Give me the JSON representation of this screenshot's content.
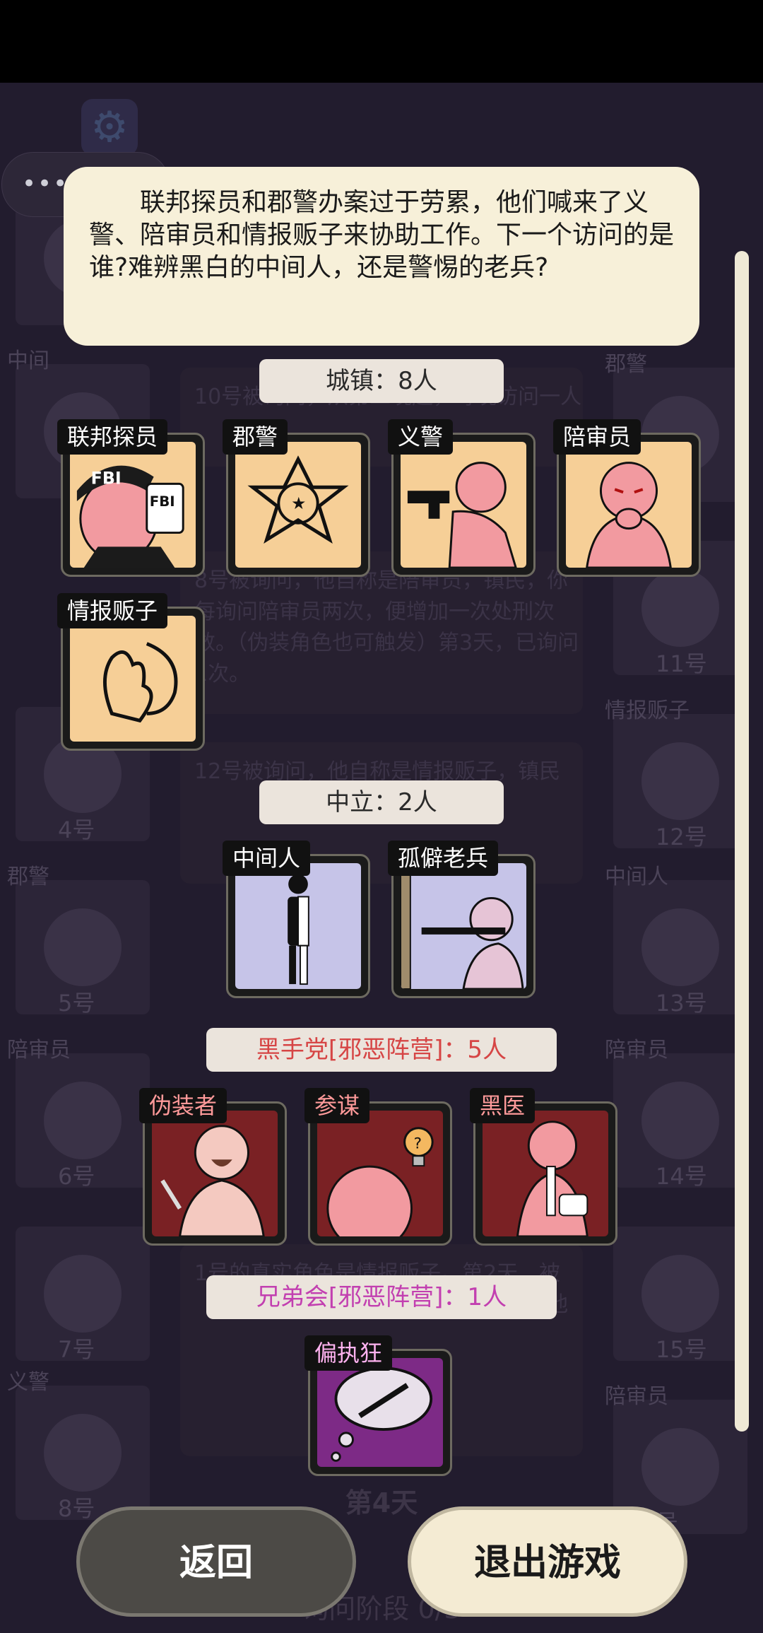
{
  "dialog": {
    "text": "联邦探员和郡警办案过于劳累，他们喊来了义警、陪审员和情报贩子来协助工作。下一个访问的是谁?难辨黑白的中间人，还是警惕的老兵?"
  },
  "sections": {
    "town": {
      "label": "城镇：8人"
    },
    "neutral": {
      "label": "中立：2人"
    },
    "black_hand": {
      "label": "黑手党[邪恶阵营]：5人"
    },
    "brotherhood": {
      "label": "兄弟会[邪恶阵营]：1人"
    }
  },
  "roles": {
    "fbi": "联邦探员",
    "sheriff": "郡警",
    "vigilante": "义警",
    "juror": "陪审员",
    "informant": "情报贩子",
    "middleman": "中间人",
    "veteran": "孤僻老兵",
    "disguiser": "伪装者",
    "strategist": "参谋",
    "doctor": "黑医",
    "paranoid": "偏执狂"
  },
  "buttons": {
    "back": "返回",
    "exit": "退出游戏"
  },
  "background": {
    "left_cards": [
      {
        "tag": "",
        "num": ""
      },
      {
        "tag": "中间",
        "num": ""
      },
      {
        "tag": "",
        "num": "4号"
      },
      {
        "tag": "郡警",
        "num": "5号"
      },
      {
        "tag": "陪审员",
        "num": "6号"
      },
      {
        "tag": "",
        "num": "7号"
      },
      {
        "tag": "义警",
        "num": "8号"
      }
    ],
    "right_cards": [
      {
        "tag": "郡警",
        "num": ""
      },
      {
        "tag": "",
        "num": "11号"
      },
      {
        "tag": "情报贩子",
        "num": "12号"
      },
      {
        "tag": "中间人",
        "num": "13号"
      },
      {
        "tag": "陪审员",
        "num": "14号"
      },
      {
        "tag": "",
        "num": "15号"
      },
      {
        "tag": "陪审员",
        "num": "号"
      }
    ],
    "log1": "10号被询问，从第二晚起，每晚访问一人",
    "log2": "8号被询问，他自称是陪审员，镇民，你每询问陪审员两次，便增加一次处刑次数。（伪装角色也可触发）第3天，已询问1次。",
    "log3": "12号被询问，他自称是情报贩子，镇民",
    "log4": "1号的真实角色是情报贩子。第2天，被（情报贩子）是伪装的角色。第3晚，他",
    "day": "第4天",
    "phase": "询问阶段 0/3"
  },
  "colors": {
    "dialog_bg": "#f7f0d9",
    "town_card": "#f6cf97",
    "neutral_card": "#c6c4e8",
    "evil_card": "#7a2124",
    "brotherhood_card": "#7d2a86",
    "evil_label_text": "#d64545",
    "brotherhood_label_text": "#c23fb0"
  }
}
